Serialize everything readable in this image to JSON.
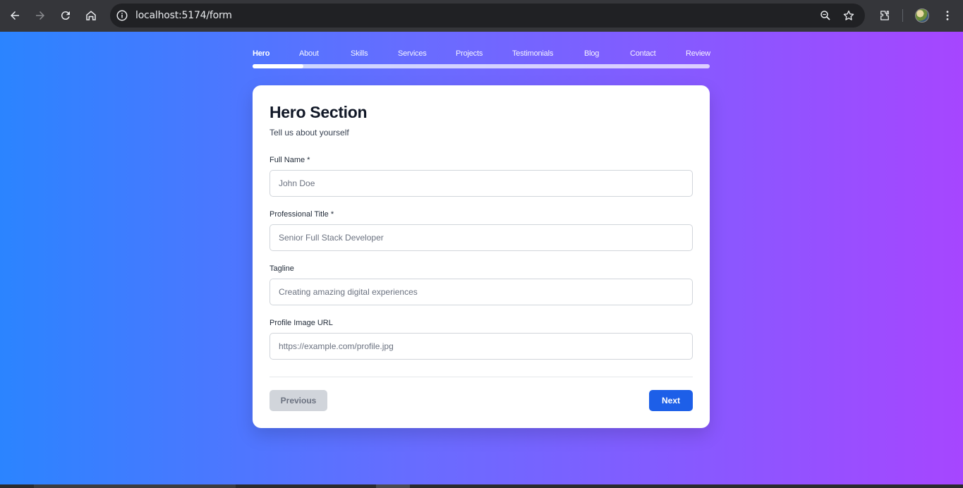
{
  "browser": {
    "url": "localhost:5174/form"
  },
  "steps": {
    "items": [
      {
        "label": "Hero",
        "active": true
      },
      {
        "label": "About",
        "active": false
      },
      {
        "label": "Skills",
        "active": false
      },
      {
        "label": "Services",
        "active": false
      },
      {
        "label": "Projects",
        "active": false
      },
      {
        "label": "Testimonials",
        "active": false
      },
      {
        "label": "Blog",
        "active": false
      },
      {
        "label": "Contact",
        "active": false
      },
      {
        "label": "Review",
        "active": false
      }
    ],
    "progress_fraction": 0.111
  },
  "form": {
    "title": "Hero Section",
    "subtitle": "Tell us about yourself",
    "fields": [
      {
        "label": "Full Name *",
        "placeholder": "John Doe",
        "value": ""
      },
      {
        "label": "Professional Title *",
        "placeholder": "Senior Full Stack Developer",
        "value": ""
      },
      {
        "label": "Tagline",
        "placeholder": "Creating amazing digital experiences",
        "value": ""
      },
      {
        "label": "Profile Image URL",
        "placeholder": "https://example.com/profile.jpg",
        "value": ""
      }
    ],
    "previous_label": "Previous",
    "next_label": "Next"
  },
  "colors": {
    "gradient_start": "#2b84ff",
    "gradient_end": "#a646ff",
    "primary_button": "#1d5fe8",
    "disabled_button": "#d1d5db"
  },
  "icons": [
    "back-icon",
    "forward-icon",
    "reload-icon",
    "home-icon",
    "site-info-icon",
    "zoom-icon",
    "bookmark-star-icon",
    "extensions-icon",
    "profile-avatar",
    "menu-kebab-icon"
  ]
}
